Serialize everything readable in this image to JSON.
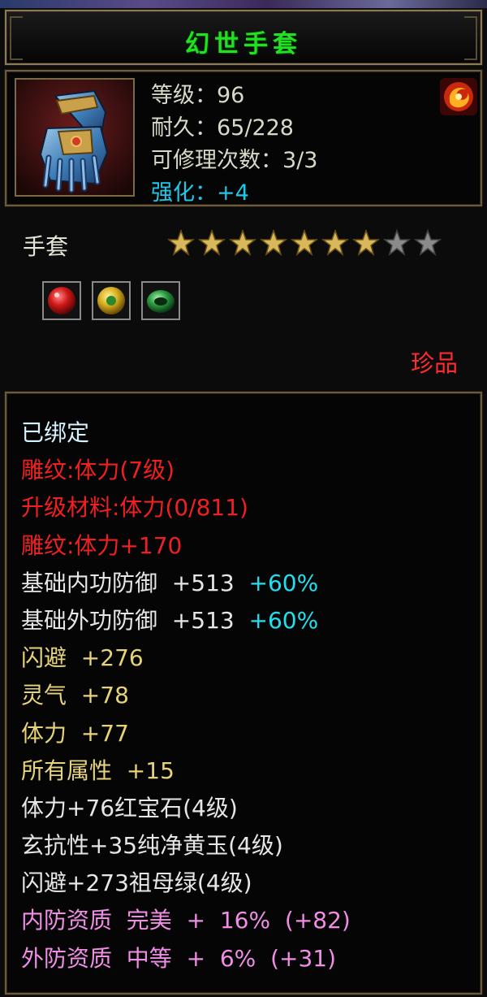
{
  "item": {
    "name": "幻世手套",
    "level_label": "等级：96",
    "durability_label": "耐久：65/228",
    "repair_label": "可修理次数：3/3",
    "enhance_label": "强化：+4",
    "type": "手套",
    "stars_filled": 7,
    "stars_total": 9,
    "rarity": "珍品",
    "icon": "gauntlet-icon",
    "badge_icon": "fire-swirl-icon",
    "gems": [
      {
        "icon": "ruby-gem-icon",
        "color": "#d01818"
      },
      {
        "icon": "yellow-jade-gem-icon",
        "color": "#d8b020"
      },
      {
        "icon": "emerald-gem-icon",
        "color": "#2a9a40"
      }
    ]
  },
  "stats": [
    {
      "text": "已绑定",
      "color": "cyanwhite"
    },
    {
      "text": "雕纹:体力(7级)",
      "color": "red"
    },
    {
      "text": "升级材料:体力(0/811)",
      "color": "red"
    },
    {
      "text": "雕纹:体力+170",
      "color": "red"
    },
    {
      "text": "基础内功防御  +513",
      "extra": "+60%",
      "color": "white"
    },
    {
      "text": "基础外功防御  +513",
      "extra": "+60%",
      "color": "white"
    },
    {
      "text": "闪避  +276",
      "color": "yellow"
    },
    {
      "text": "灵气  +78",
      "color": "yellow"
    },
    {
      "text": "体力  +77",
      "color": "yellow"
    },
    {
      "text": "所有属性  +15",
      "color": "yellow"
    },
    {
      "text": "体力+76红宝石(4级)",
      "color": "white"
    },
    {
      "text": "玄抗性+35纯净黄玉(4级)",
      "color": "white"
    },
    {
      "text": "闪避+273祖母绿(4级)",
      "color": "white"
    },
    {
      "text": "内防资质  完美  +  16%  (+82)",
      "color": "pink"
    },
    {
      "text": "外防资质  中等  +  6%  (+31)",
      "color": "pink"
    }
  ],
  "colors": {
    "title": "#22e022",
    "enhance": "#1ec8e6",
    "rarity": "#ff2a2a",
    "red": "#f02020",
    "yellow": "#e6d37a",
    "pink": "#f08ee6",
    "cyan": "#20e0f0",
    "star_filled": "#d8b85a",
    "star_empty": "#8a8a8a"
  }
}
